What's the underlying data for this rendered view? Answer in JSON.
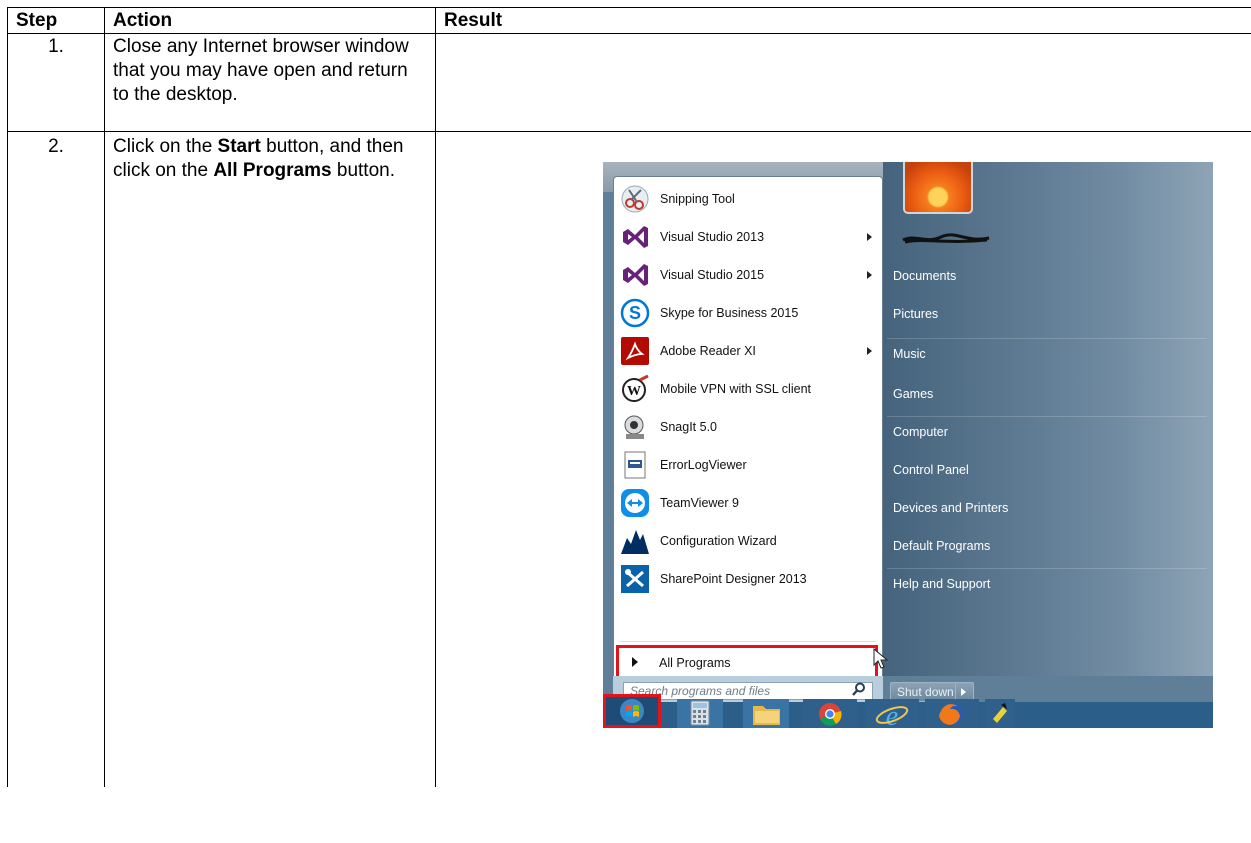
{
  "table": {
    "headers": {
      "step": "Step",
      "action": "Action",
      "result": "Result"
    },
    "rows": [
      {
        "step": "1.",
        "action": "Close any Internet browser window that you may have open and return to the desktop.",
        "result": ""
      },
      {
        "step": "2.",
        "action_parts": [
          "Click on the ",
          "Start",
          " button, and then click on the ",
          "All Programs",
          " button."
        ],
        "result": ""
      }
    ]
  },
  "start_menu": {
    "programs": [
      {
        "label": "Snipping Tool",
        "icon": "scissors-icon",
        "submenu": false
      },
      {
        "label": "Visual Studio 2013",
        "icon": "visual-studio-icon",
        "submenu": true
      },
      {
        "label": "Visual Studio 2015",
        "icon": "visual-studio-icon",
        "submenu": true
      },
      {
        "label": "Skype for Business 2015",
        "icon": "skype-icon",
        "submenu": false
      },
      {
        "label": "Adobe Reader XI",
        "icon": "adobe-reader-icon",
        "submenu": true
      },
      {
        "label": "Mobile VPN with SSL client",
        "icon": "vpn-icon",
        "submenu": false
      },
      {
        "label": "SnagIt 5.0",
        "icon": "snagit-icon",
        "submenu": false
      },
      {
        "label": "ErrorLogViewer",
        "icon": "log-viewer-icon",
        "submenu": false
      },
      {
        "label": "TeamViewer 9",
        "icon": "teamviewer-icon",
        "submenu": false
      },
      {
        "label": "Configuration Wizard",
        "icon": "configuration-wizard-icon",
        "submenu": false
      },
      {
        "label": "SharePoint Designer 2013",
        "icon": "sharepoint-designer-icon",
        "submenu": false
      }
    ],
    "all_programs": "All Programs",
    "search_placeholder": "Search programs and files",
    "right_items": [
      "Documents",
      "Pictures",
      "Music",
      "Games",
      "Computer",
      "Control Panel",
      "Devices and Printers",
      "Default Programs",
      "Help and Support"
    ],
    "shutdown": "Shut down",
    "highlight_color": "#e2131a"
  },
  "taskbar": {
    "icons": [
      "start-orb-icon",
      "calculator-icon",
      "file-explorer-icon",
      "chrome-icon",
      "internet-explorer-icon",
      "firefox-icon"
    ]
  }
}
